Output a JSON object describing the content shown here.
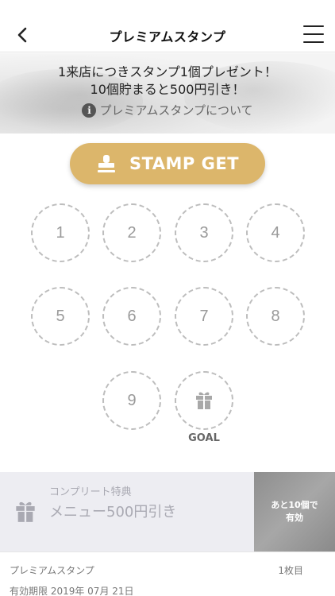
{
  "header": {
    "title": "プレミアムスタンプ"
  },
  "banner": {
    "line1": "1来店につきスタンプ1個プレゼント！",
    "line2": "10個貯まると500円引き！",
    "about_label": "プレミアムスタンプについて",
    "info_glyph": "i"
  },
  "stamp_button": {
    "label": "STAMP GET"
  },
  "stamps": {
    "slots": [
      "1",
      "2",
      "3",
      "4",
      "5",
      "6",
      "7",
      "8",
      "9"
    ],
    "goal_label": "GOAL"
  },
  "reward": {
    "title": "コンプリート特典",
    "text": "メニュー500円引き",
    "remaining_line1": "あと10個で",
    "remaining_line2": "有効"
  },
  "footer": {
    "card_name": "プレミアムスタンプ",
    "card_count": "1枚目",
    "expiry": "有効期限 2019年 07月 21日"
  },
  "colors": {
    "accent": "#dcb66b",
    "slot_border": "#bdbdbd",
    "reward_bg": "#ededf2"
  }
}
